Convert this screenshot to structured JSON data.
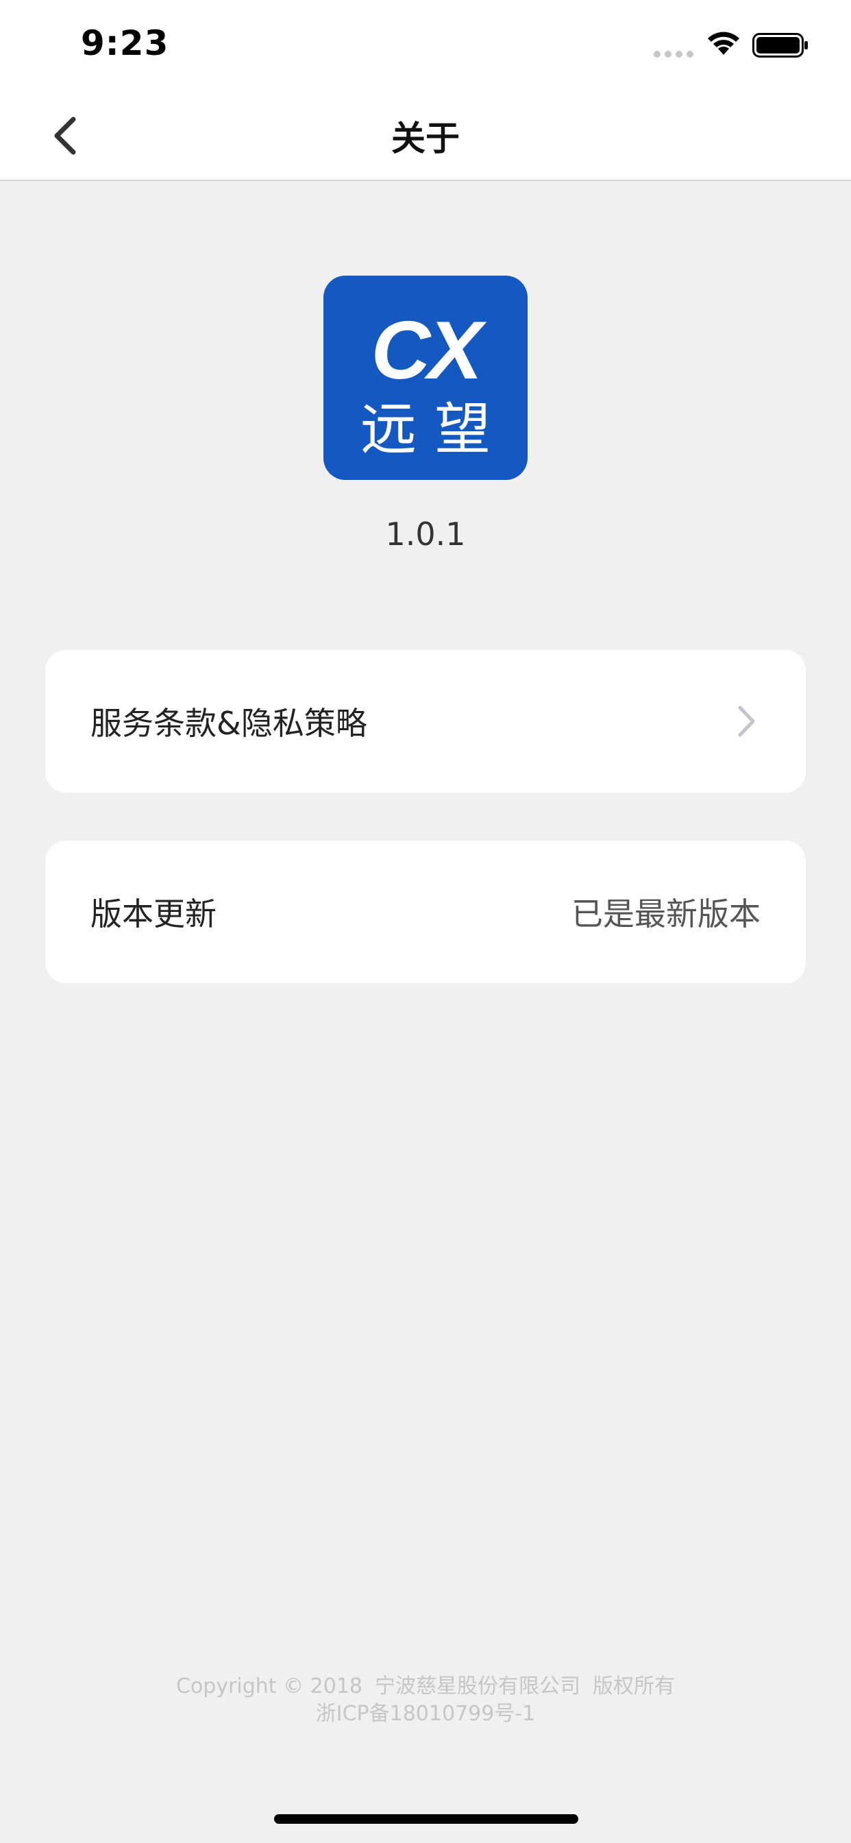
{
  "status_bar": {
    "time": "9:23",
    "icons": [
      "signal-dots-icon",
      "wifi-icon",
      "battery-icon"
    ]
  },
  "nav": {
    "title": "关于",
    "back_icon": "chevron-left-icon"
  },
  "app": {
    "logo_text_top": "CX",
    "logo_text_bottom": "远 望",
    "logo_color": "#1458c2",
    "version": "1.0.1"
  },
  "menu": {
    "terms_label": "服务条款&隐私策略",
    "terms_icon": "chevron-right-icon",
    "update_label": "版本更新",
    "update_status": "已是最新版本"
  },
  "footer": {
    "copyright": "Copyright © 2018",
    "company": "宁波慈星股份有限公司",
    "rights": "版权所有",
    "icp": "浙ICP备18010799号-1"
  }
}
